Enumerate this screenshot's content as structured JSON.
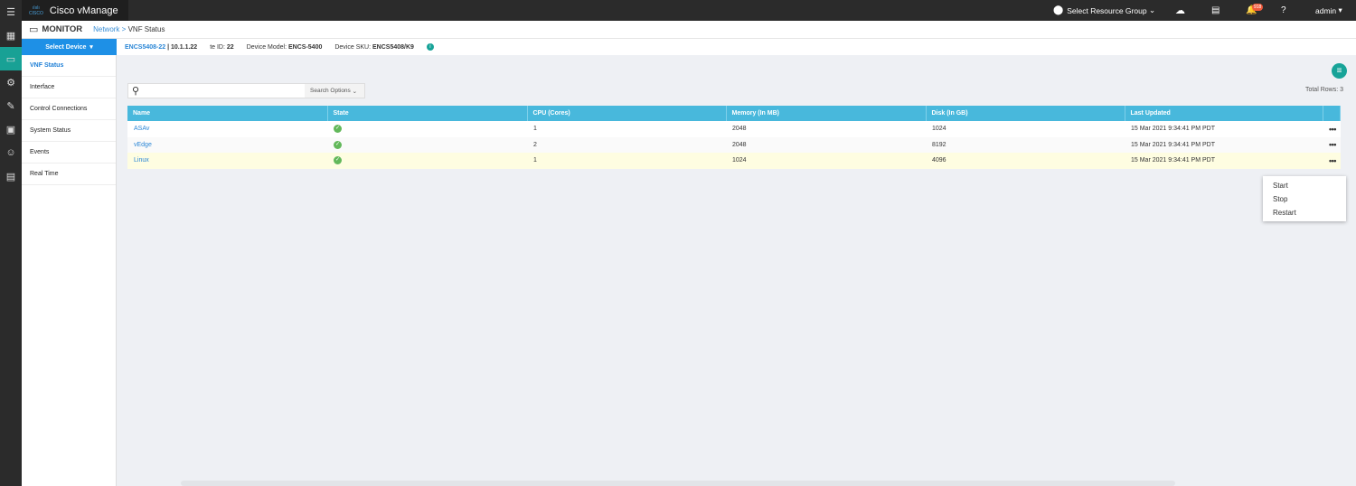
{
  "app": {
    "title": "Cisco vManage",
    "logo": "cisco"
  },
  "topbar": {
    "resource_group": "Select Resource Group",
    "notifications": "918",
    "user": "admin"
  },
  "header": {
    "section": "MONITOR",
    "breadcrumb": [
      "Network",
      ">",
      "VNF Status"
    ]
  },
  "device": {
    "select_label": "Select Device",
    "name": "ENCS5408-22",
    "ip": "| 10.1.1.22",
    "site_label": "te ID:",
    "site_id": "22",
    "model_label": "Device Model:",
    "model": "ENCS-5400",
    "sku_label": "Device SKU:",
    "sku": "ENCS5408/K9"
  },
  "sidebar": {
    "items": [
      {
        "label": "VNF Status"
      },
      {
        "label": "Interface"
      },
      {
        "label": "Control Connections"
      },
      {
        "label": "System Status"
      },
      {
        "label": "Events"
      },
      {
        "label": "Real Time"
      }
    ]
  },
  "search": {
    "placeholder": "",
    "options_label": "Search Options"
  },
  "total_rows": "Total Rows: 3",
  "table": {
    "headers": [
      "Name",
      "State",
      "CPU (Cores)",
      "Memory (In MB)",
      "Disk (In GB)",
      "Last Updated"
    ],
    "rows": [
      {
        "name": "ASAv",
        "cpu": "1",
        "memory": "2048",
        "disk": "1024",
        "updated": "15 Mar 2021 9:34:41 PM PDT"
      },
      {
        "name": "vEdge",
        "cpu": "2",
        "memory": "2048",
        "disk": "8192",
        "updated": "15 Mar 2021 9:34:41 PM PDT"
      },
      {
        "name": "Linux",
        "cpu": "1",
        "memory": "1024",
        "disk": "4096",
        "updated": "15 Mar 2021 9:34:41 PM PDT"
      }
    ]
  },
  "context_menu": [
    "Start",
    "Stop",
    "Restart"
  ]
}
